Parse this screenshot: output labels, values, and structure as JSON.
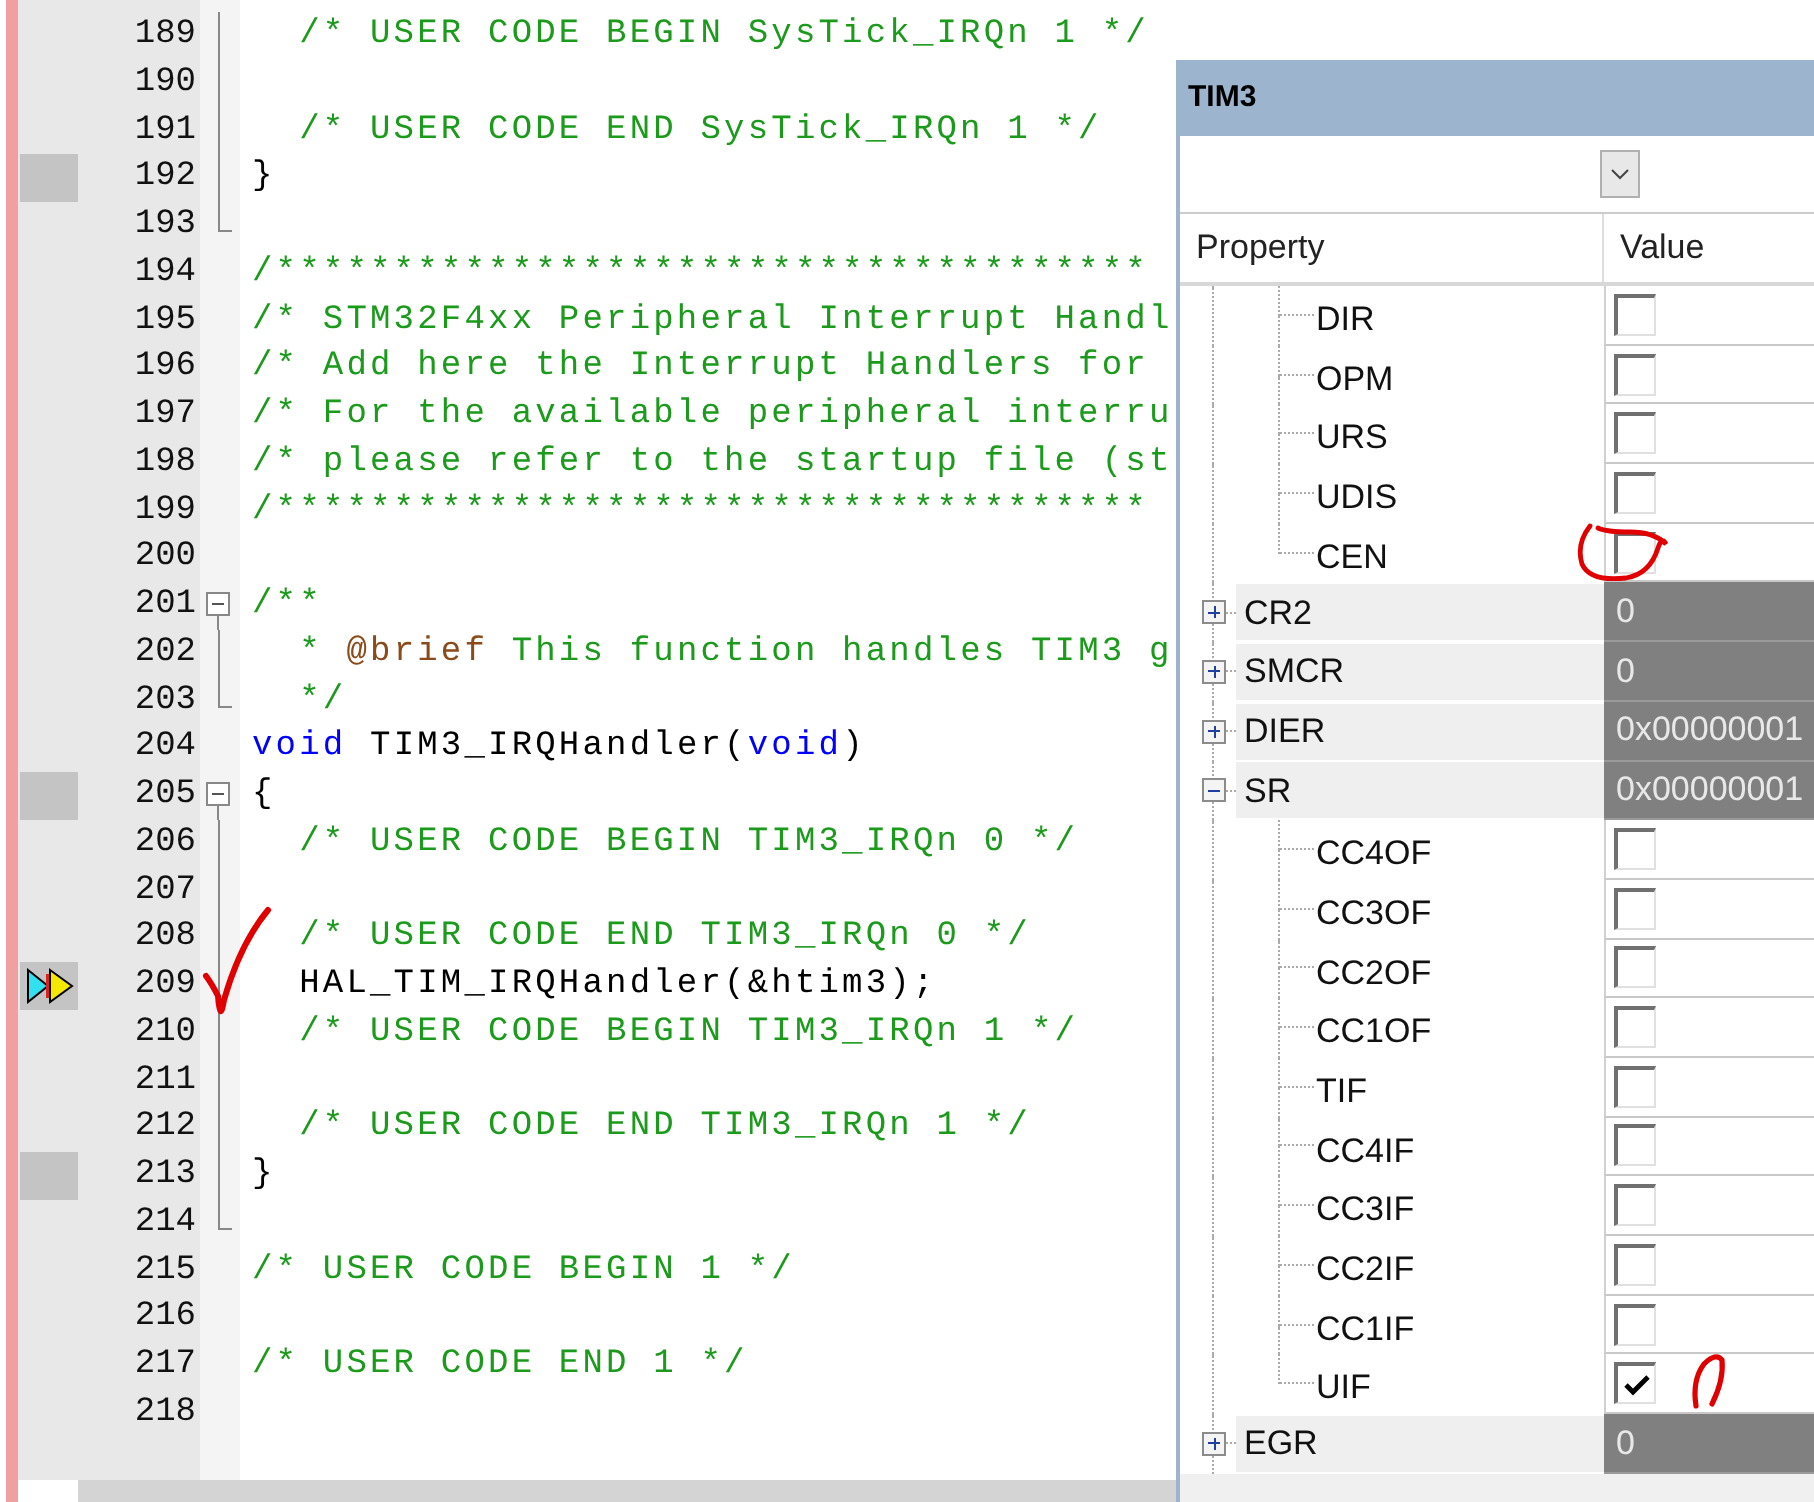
{
  "editor": {
    "lines": [
      {
        "number": "189",
        "fold": {
          "kind": "inside"
        },
        "segments": [
          {
            "kind": "comment",
            "text": "  /* USER CODE BEGIN SysTick_IRQn 1 */"
          }
        ]
      },
      {
        "number": "190",
        "fold": {
          "kind": "inside"
        }
      },
      {
        "number": "191",
        "fold": {
          "kind": "inside"
        },
        "segments": [
          {
            "kind": "comment",
            "text": "  /* USER CODE END SysTick_IRQn 1 */"
          }
        ]
      },
      {
        "number": "192",
        "fold": {
          "kind": "inside"
        },
        "marker": {
          "kind": "code"
        },
        "segments": [
          {
            "kind": "plain",
            "text": "}"
          }
        ]
      },
      {
        "number": "193",
        "fold": {
          "kind": "end"
        }
      },
      {
        "number": "194",
        "segments": [
          {
            "kind": "comment",
            "text": "/*************************************"
          }
        ]
      },
      {
        "number": "195",
        "segments": [
          {
            "kind": "comment",
            "text": "/* STM32F4xx Peripheral Interrupt Handl"
          }
        ]
      },
      {
        "number": "196",
        "segments": [
          {
            "kind": "comment",
            "text": "/* Add here the Interrupt Handlers for"
          }
        ]
      },
      {
        "number": "197",
        "segments": [
          {
            "kind": "comment",
            "text": "/* For the available peripheral interru"
          }
        ]
      },
      {
        "number": "198",
        "segments": [
          {
            "kind": "comment",
            "text": "/* please refer to the startup file (st"
          }
        ]
      },
      {
        "number": "199",
        "segments": [
          {
            "kind": "comment",
            "text": "/*************************************"
          }
        ]
      },
      {
        "number": "200"
      },
      {
        "number": "201",
        "fold": {
          "kind": "start"
        },
        "segments": [
          {
            "kind": "comment",
            "text": "/**"
          }
        ]
      },
      {
        "number": "202",
        "fold": {
          "kind": "inside"
        },
        "segments": [
          {
            "kind": "comment",
            "text": "  * "
          },
          {
            "kind": "doc-tag",
            "text": "@brief"
          },
          {
            "kind": "comment",
            "text": " This function handles TIM3 g"
          }
        ]
      },
      {
        "number": "203",
        "fold": {
          "kind": "end"
        },
        "segments": [
          {
            "kind": "comment",
            "text": "  */"
          }
        ]
      },
      {
        "number": "204",
        "segments": [
          {
            "kind": "keyword",
            "text": "void"
          },
          {
            "kind": "plain",
            "text": " TIM3_IRQHandler("
          },
          {
            "kind": "keyword",
            "text": "void"
          },
          {
            "kind": "plain",
            "text": ")"
          }
        ]
      },
      {
        "number": "205",
        "fold": {
          "kind": "start"
        },
        "marker": {
          "kind": "code"
        },
        "segments": [
          {
            "kind": "plain",
            "text": "{"
          }
        ]
      },
      {
        "number": "206",
        "fold": {
          "kind": "inside"
        },
        "segments": [
          {
            "kind": "comment",
            "text": "  /* USER CODE BEGIN TIM3_IRQn 0 */"
          }
        ]
      },
      {
        "number": "207",
        "fold": {
          "kind": "inside"
        }
      },
      {
        "number": "208",
        "fold": {
          "kind": "inside"
        },
        "segments": [
          {
            "kind": "comment",
            "text": "  /* USER CODE END TIM3_IRQn 0 */"
          }
        ]
      },
      {
        "number": "209",
        "fold": {
          "kind": "inside"
        },
        "marker": {
          "kind": "current"
        },
        "segments": [
          {
            "kind": "plain",
            "text": "  HAL_TIM_IRQHandler(&htim3);"
          }
        ]
      },
      {
        "number": "210",
        "fold": {
          "kind": "inside"
        },
        "segments": [
          {
            "kind": "comment",
            "text": "  /* USER CODE BEGIN TIM3_IRQn 1 */"
          }
        ]
      },
      {
        "number": "211",
        "fold": {
          "kind": "inside"
        }
      },
      {
        "number": "212",
        "fold": {
          "kind": "inside"
        },
        "segments": [
          {
            "kind": "comment",
            "text": "  /* USER CODE END TIM3_IRQn 1 */"
          }
        ]
      },
      {
        "number": "213",
        "fold": {
          "kind": "inside"
        },
        "marker": {
          "kind": "code"
        },
        "segments": [
          {
            "kind": "plain",
            "text": "}"
          }
        ]
      },
      {
        "number": "214",
        "fold": {
          "kind": "end"
        }
      },
      {
        "number": "215",
        "segments": [
          {
            "kind": "comment",
            "text": "/* USER CODE BEGIN 1 */"
          }
        ]
      },
      {
        "number": "216"
      },
      {
        "number": "217",
        "segments": [
          {
            "kind": "comment",
            "text": "/* USER CODE END 1 */"
          }
        ]
      },
      {
        "number": "218"
      }
    ]
  },
  "peripheral_panel": {
    "title": "TIM3",
    "columns": [
      "Property",
      "Value"
    ],
    "continued_bits": [
      {
        "name": "DIR",
        "checked": false
      },
      {
        "name": "OPM",
        "checked": false
      },
      {
        "name": "URS",
        "checked": false
      },
      {
        "name": "UDIS",
        "checked": false
      },
      {
        "name": "CEN",
        "checked": false
      }
    ],
    "registers": [
      {
        "name": "CR2",
        "value": "0",
        "expanded": false
      },
      {
        "name": "SMCR",
        "value": "0",
        "expanded": false
      },
      {
        "name": "DIER",
        "value": "0x00000001",
        "expanded": false
      },
      {
        "name": "SR",
        "value": "0x00000001",
        "expanded": true,
        "children": [
          {
            "name": "CC4OF",
            "checked": false
          },
          {
            "name": "CC3OF",
            "checked": false
          },
          {
            "name": "CC2OF",
            "checked": false
          },
          {
            "name": "CC1OF",
            "checked": false
          },
          {
            "name": "TIF",
            "checked": false
          },
          {
            "name": "CC4IF",
            "checked": false
          },
          {
            "name": "CC3IF",
            "checked": false
          },
          {
            "name": "CC2IF",
            "checked": false
          },
          {
            "name": "CC1IF",
            "checked": false
          },
          {
            "name": "UIF",
            "checked": true
          }
        ]
      },
      {
        "name": "EGR",
        "value": "0",
        "expanded": false
      }
    ]
  }
}
